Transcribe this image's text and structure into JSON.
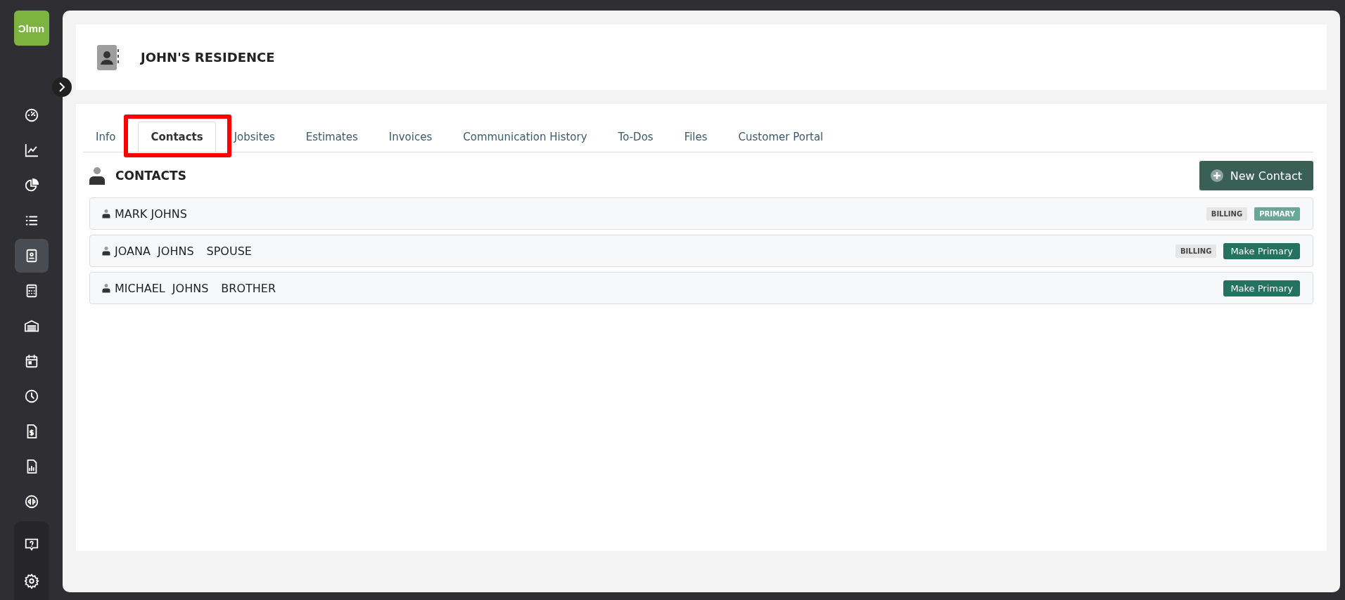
{
  "logo": "Ɔlmn",
  "sidebar": {
    "items": [
      {
        "kind": "dashboard",
        "selected": false
      },
      {
        "kind": "chart",
        "selected": false
      },
      {
        "kind": "pie",
        "selected": false
      },
      {
        "kind": "list",
        "selected": false
      },
      {
        "kind": "contact",
        "selected": true
      },
      {
        "kind": "calculator",
        "selected": false
      },
      {
        "kind": "garage",
        "selected": false
      },
      {
        "kind": "calendar",
        "selected": false
      },
      {
        "kind": "clock",
        "selected": false
      },
      {
        "kind": "invoice",
        "selected": false
      },
      {
        "kind": "report",
        "selected": false
      },
      {
        "kind": "qb",
        "selected": false
      }
    ],
    "bottom_items": [
      {
        "kind": "help"
      },
      {
        "kind": "settings"
      }
    ]
  },
  "header": {
    "title": "JOHN'S RESIDENCE"
  },
  "tabs": [
    {
      "label": "Info",
      "selected": false,
      "highlighted": false
    },
    {
      "label": "Contacts",
      "selected": true,
      "highlighted": true
    },
    {
      "label": "Jobsites",
      "selected": false,
      "highlighted": false
    },
    {
      "label": "Estimates",
      "selected": false,
      "highlighted": false
    },
    {
      "label": "Invoices",
      "selected": false,
      "highlighted": false
    },
    {
      "label": "Communication History",
      "selected": false,
      "highlighted": false
    },
    {
      "label": "To-Dos",
      "selected": false,
      "highlighted": false
    },
    {
      "label": "Files",
      "selected": false,
      "highlighted": false
    },
    {
      "label": "Customer Portal",
      "selected": false,
      "highlighted": false
    }
  ],
  "section": {
    "title": "CONTACTS",
    "new_button": "New Contact"
  },
  "contacts": [
    {
      "name": "MARK JOHNS",
      "tags": [
        {
          "label": "BILLING",
          "kind": "billing"
        },
        {
          "label": "PRIMARY",
          "kind": "primary"
        }
      ]
    },
    {
      "name": "JOANA  JOHNS",
      "relation": "SPOUSE",
      "tags": [
        {
          "label": "BILLING",
          "kind": "billing"
        }
      ],
      "action": "Make Primary"
    },
    {
      "name": "MICHAEL  JOHNS",
      "relation": "BROTHER",
      "action": "Make Primary"
    }
  ]
}
